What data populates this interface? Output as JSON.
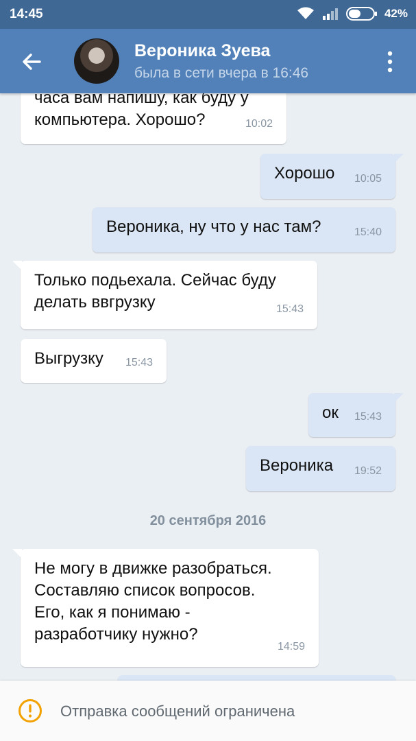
{
  "status_bar": {
    "time": "14:45",
    "battery": "42%",
    "icons": [
      "wifi-icon",
      "signal-icon",
      "battery-icon"
    ]
  },
  "header": {
    "name": "Вероника Зуева",
    "status": "была в сети вчера в 16:46",
    "icons": [
      "back-arrow-icon",
      "more-vertical-icon"
    ]
  },
  "messages": [
    {
      "dir": "in",
      "text": "часа вам напишу, как буду у\nкомпьютера. Хорошо?",
      "time": "10:02"
    },
    {
      "dir": "out",
      "text": "Хорошо",
      "time": "10:05"
    },
    {
      "dir": "out",
      "text": "Вероника, ну что у нас там?",
      "time": "15:40"
    },
    {
      "dir": "in",
      "text": "Только подьехала. Сейчас буду\nделать ввгрузку",
      "time": "15:43"
    },
    {
      "dir": "in",
      "text": "Выгрузку",
      "time": "15:43"
    },
    {
      "dir": "out",
      "text": "ок",
      "time": "15:43"
    },
    {
      "dir": "out",
      "text": "Вероника",
      "time": "19:52"
    },
    {
      "dir": "in",
      "text": "Не могу в движке разобраться.\nСоставляю список вопросов.\nЕго, как я понимаю -\nразработчику нужно?",
      "time": "14:59"
    }
  ],
  "date_separator": "20 сентября 2016",
  "footer": {
    "notice": "Отправка сообщений ограничена",
    "icon": "warning-icon"
  },
  "colors": {
    "header": "#5181b8",
    "status_bar": "#3f6895",
    "incoming": "#ffffff",
    "outgoing": "#dae6f5",
    "warning": "#f2a100"
  }
}
